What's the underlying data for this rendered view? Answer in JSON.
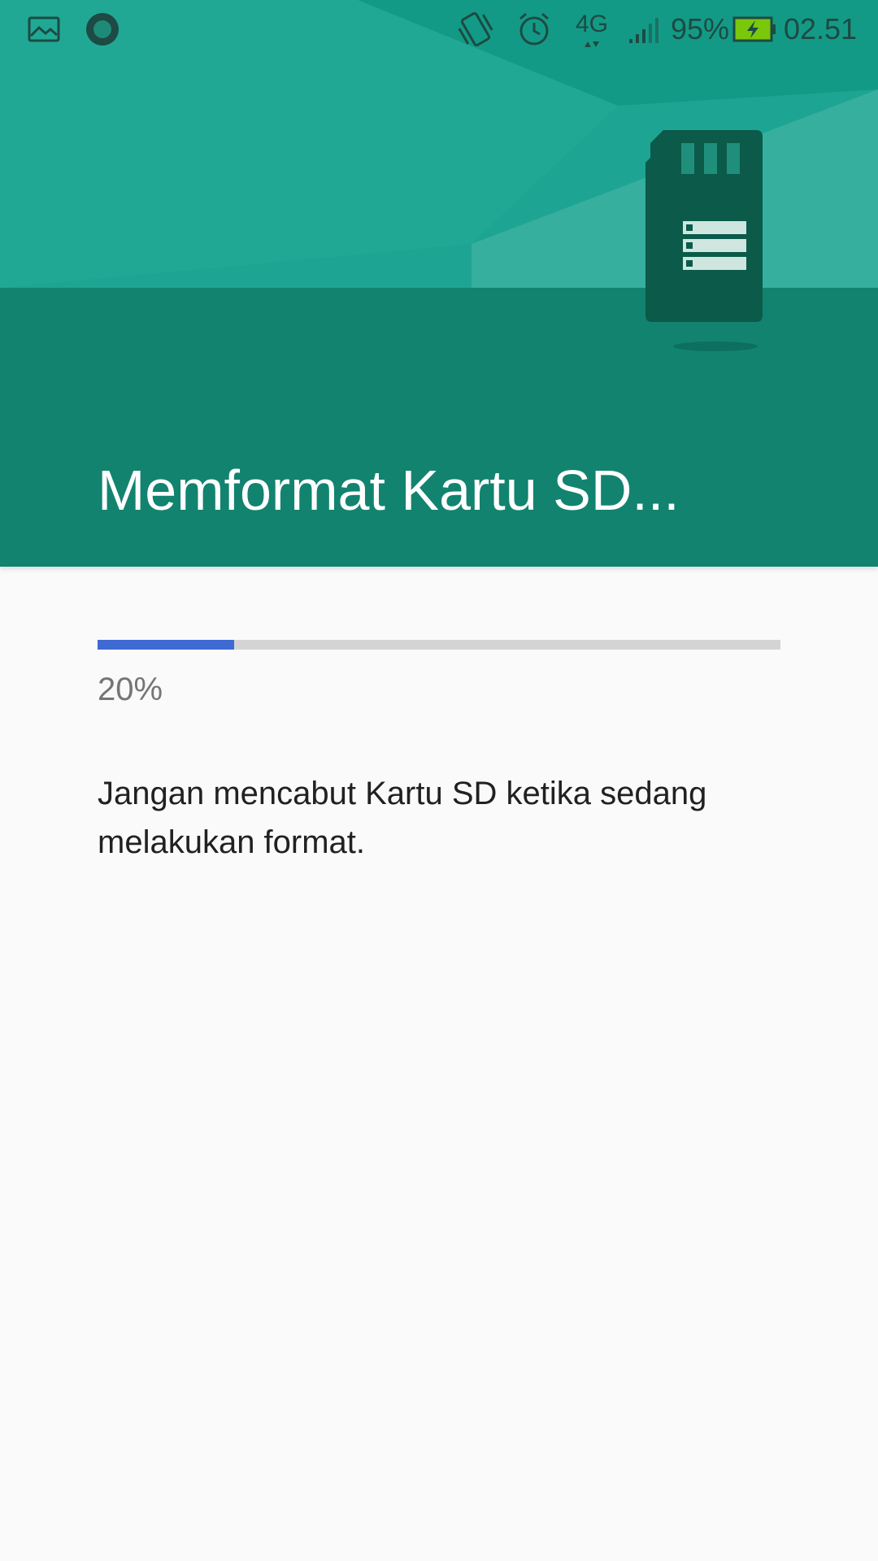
{
  "status_bar": {
    "left_icons": [
      "gallery-notification-icon",
      "circle-notification-icon"
    ],
    "right_icons": [
      "vibrate-icon",
      "alarm-icon",
      "network-4g-icon",
      "signal-icon",
      "battery-charging-icon"
    ],
    "network_label": "4G",
    "battery_percent": "95%",
    "time": "02.51"
  },
  "header": {
    "title": "Memformat Kartu SD...",
    "illustration": "sd-card-icon"
  },
  "progress": {
    "value": 0.2,
    "label": "20%"
  },
  "message": "Jangan mencabut Kartu SD ketika sedang melakukan format.",
  "colors": {
    "header_dark": "#12836f",
    "header_light": "#1ea492",
    "progress_fill": "#3f6ad4",
    "progress_track": "#d4d4d4",
    "background": "#fafafa",
    "battery_fill": "#7ac70c",
    "sd_card": "#0b5a4a"
  }
}
